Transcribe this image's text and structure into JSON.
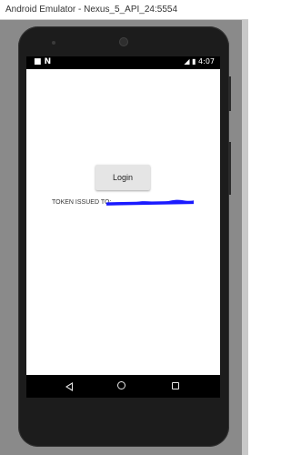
{
  "window": {
    "title": "Android Emulator - Nexus_5_API_24:5554"
  },
  "statusbar": {
    "left_icons": "■ N",
    "right": "◢ ▮ 4:07"
  },
  "app": {
    "login_label": "Login",
    "token_label": "TOKEN ISSUED TO:"
  },
  "colors": {
    "redaction": "#1a1aff"
  },
  "icons": {
    "nav_back": "back-icon",
    "nav_home": "home-icon",
    "nav_recents": "recents-icon"
  }
}
